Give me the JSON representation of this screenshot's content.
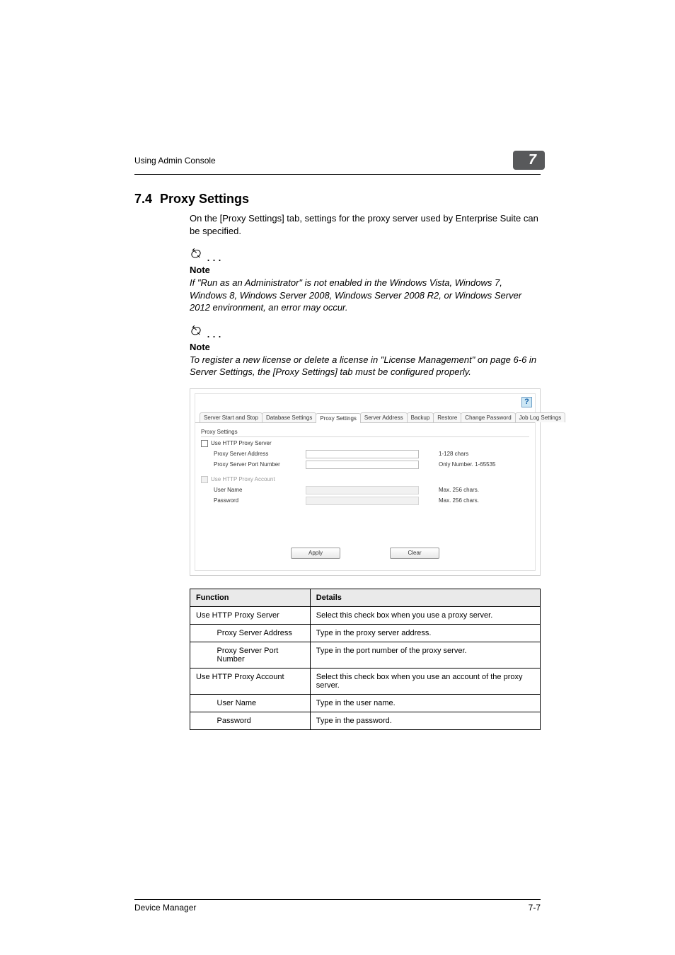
{
  "running_head": {
    "text": "Using Admin Console",
    "chapter_num": "7"
  },
  "section": {
    "number": "7.4",
    "title": "Proxy Settings"
  },
  "intro_para": "On the [Proxy Settings] tab, settings for the proxy server used by Enterprise Suite can be specified.",
  "notes": [
    {
      "label": "Note",
      "body": "If \"Run as an Administrator\" is not enabled in the Windows Vista, Windows 7, Windows 8, Windows Server 2008, Windows Server 2008 R2, or Windows Server 2012 environment, an error may occur."
    },
    {
      "label": "Note",
      "body": "To register a new license or delete a license in \"License Management\" on page 6-6 in Server Settings, the [Proxy Settings] tab must be configured properly."
    }
  ],
  "screenshot": {
    "help": "?",
    "tabs": [
      "Server Start and Stop",
      "Database Settings",
      "Proxy Settings",
      "Server Address",
      "Backup",
      "Restore",
      "Change Password",
      "Job Log Settings"
    ],
    "active_tab_index": 2,
    "panel_title": "Proxy Settings",
    "chk_use_proxy_server": "Use HTTP Proxy Server",
    "fields_server": [
      {
        "label": "Proxy Server Address",
        "hint": "1-128 chars"
      },
      {
        "label": "Proxy Server Port Number",
        "hint": "Only Number. 1-65535"
      }
    ],
    "chk_use_proxy_account": "Use HTTP Proxy Account",
    "fields_account": [
      {
        "label": "User Name",
        "hint": "Max. 256 chars."
      },
      {
        "label": "Password",
        "hint": "Max. 256 chars."
      }
    ],
    "buttons": {
      "apply": "Apply",
      "clear": "Clear"
    }
  },
  "table": {
    "head": {
      "function": "Function",
      "details": "Details"
    },
    "rows": [
      {
        "span": true,
        "function": "Use HTTP Proxy Server",
        "details": "Select this check box when you use a proxy server."
      },
      {
        "span": false,
        "function": "Proxy Server Address",
        "details": "Type in the proxy server address."
      },
      {
        "span": false,
        "function": "Proxy Server Port Number",
        "details": "Type in the port number of the proxy server."
      },
      {
        "span": true,
        "function": "Use HTTP Proxy Account",
        "details": "Select this check box when you use an account of the proxy server."
      },
      {
        "span": false,
        "function": "User Name",
        "details": "Type in the user name."
      },
      {
        "span": false,
        "function": "Password",
        "details": "Type in the password."
      }
    ]
  },
  "footer": {
    "left": "Device Manager",
    "right": "7-7"
  }
}
